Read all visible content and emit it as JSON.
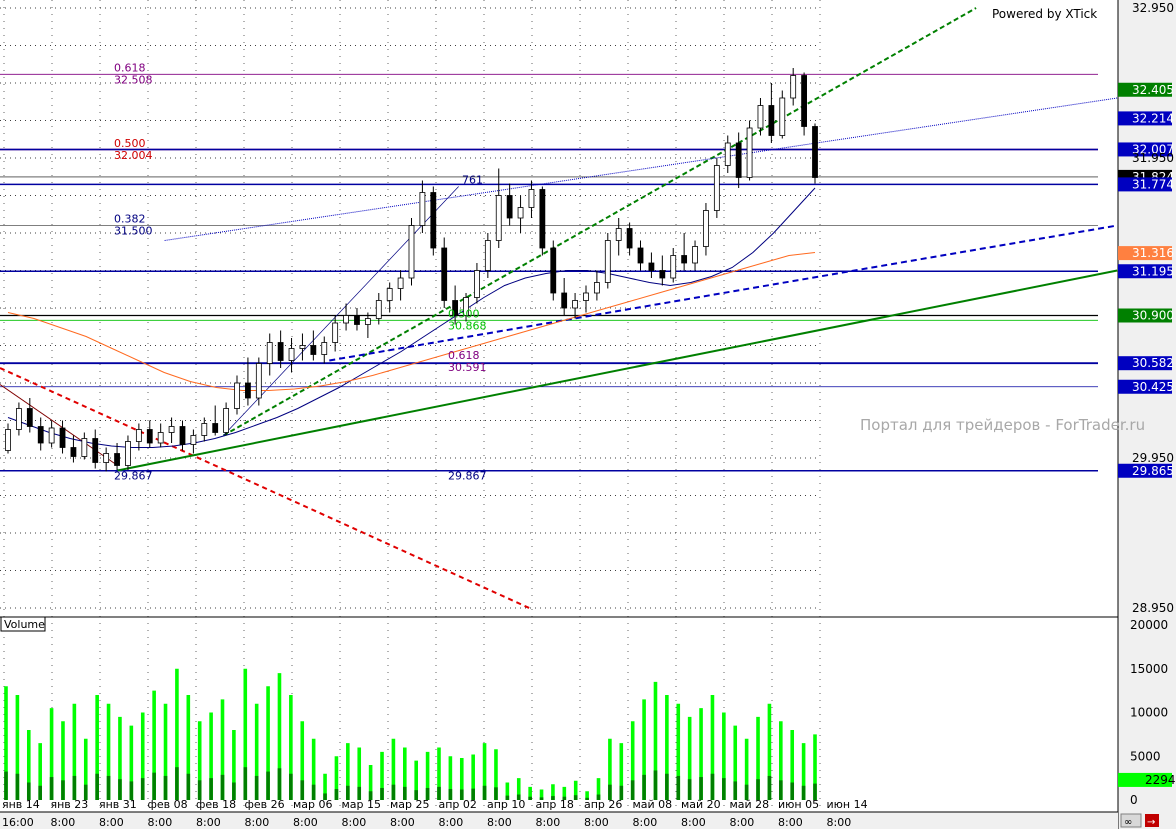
{
  "watermark": "Powered by XTick",
  "portal": "Портал для трейдеров - ForTrader.ru",
  "volume_label": "Volume",
  "colors": {
    "up": "#000000",
    "grid": "#000000",
    "fib_purple": "#800080",
    "fib_red": "#d00000",
    "fib_blue": "#000080",
    "fib_green": "#00c000",
    "hline_blue": "#0000a0",
    "trend_green": "#008000",
    "trend_red": "#e00000",
    "ma_orange": "#ff6a20",
    "ma_blue": "#000080",
    "volume": "#00ff00",
    "volume_dark": "#008000"
  },
  "chart_data": [
    {
      "type": "candlestick",
      "title": "",
      "ylim": [
        28.95,
        32.95
      ],
      "y_ticks": [
        "32.950",
        "31.950",
        "29.950",
        "28.950"
      ],
      "price_labels": [
        {
          "value": "32.405",
          "y": 32.405,
          "bg": "#008000",
          "fg": "#ffffff"
        },
        {
          "value": "32.214",
          "y": 32.214,
          "bg": "#0000c0",
          "fg": "#ffffff"
        },
        {
          "value": "32.007",
          "y": 32.007,
          "bg": "#0000c0",
          "fg": "#ffffff"
        },
        {
          "value": "31.824",
          "y": 31.824,
          "bg": "#000000",
          "fg": "#ffffff"
        },
        {
          "value": "31.774",
          "y": 31.774,
          "bg": "#0000c0",
          "fg": "#ffffff"
        },
        {
          "value": "31.316",
          "y": 31.316,
          "bg": "#ff8040",
          "fg": "#ffffff"
        },
        {
          "value": "31.195",
          "y": 31.195,
          "bg": "#0000c0",
          "fg": "#ffffff"
        },
        {
          "value": "30.900",
          "y": 30.9,
          "bg": "#008000",
          "fg": "#ffffff"
        },
        {
          "value": "30.582",
          "y": 30.582,
          "bg": "#0000c0",
          "fg": "#ffffff"
        },
        {
          "value": "30.425",
          "y": 30.425,
          "bg": "#0000c0",
          "fg": "#ffffff"
        },
        {
          "value": "29.865",
          "y": 29.865,
          "bg": "#0000c0",
          "fg": "#ffffff"
        }
      ],
      "fib_labels": [
        {
          "text": "0.618",
          "y": 32.508,
          "row": 0,
          "color": "#800080",
          "set": "a"
        },
        {
          "text": "32.508",
          "y": 32.508,
          "row": 1,
          "color": "#800080",
          "set": "a"
        },
        {
          "text": "0.500",
          "y": 32.004,
          "row": 0,
          "color": "#d00000",
          "set": "a"
        },
        {
          "text": "32.004",
          "y": 32.004,
          "row": 1,
          "color": "#d00000",
          "set": "a"
        },
        {
          "text": "0.382",
          "y": 31.5,
          "row": 0,
          "color": "#000080",
          "set": "a"
        },
        {
          "text": "31.500",
          "y": 31.5,
          "row": 1,
          "color": "#000080",
          "set": "a"
        },
        {
          "text": "29.867",
          "y": 29.867,
          "row": 1,
          "color": "#000080",
          "set": "a"
        },
        {
          "text": "0.500",
          "y": 30.868,
          "row": 0,
          "color": "#00c000",
          "set": "b"
        },
        {
          "text": "30.868",
          "y": 30.868,
          "row": 1,
          "color": "#00c000",
          "set": "b"
        },
        {
          "text": "0.618",
          "y": 30.591,
          "row": 0,
          "color": "#800080",
          "set": "b"
        },
        {
          "text": "30.591",
          "y": 30.591,
          "row": 1,
          "color": "#800080",
          "set": "b"
        },
        {
          "text": "29.867",
          "y": 29.867,
          "row": 1,
          "color": "#000080",
          "set": "b"
        },
        {
          "text": "761",
          "y": 31.76,
          "row": 0,
          "color": "#000080",
          "set": "c"
        }
      ],
      "hlines": [
        {
          "y": 32.007,
          "color": "#800080",
          "width": 1.5
        },
        {
          "y": 32.007,
          "color": "#0000a0",
          "width": 1.5
        },
        {
          "y": 31.774,
          "color": "#0000a0",
          "width": 1.5
        },
        {
          "y": 31.824,
          "color": "#000000",
          "width": 0.6
        },
        {
          "y": 31.195,
          "color": "#0000a0",
          "width": 1.5
        },
        {
          "y": 30.9,
          "color": "#000000",
          "width": 1.2
        },
        {
          "y": 30.582,
          "color": "#0000a0",
          "width": 1.8
        },
        {
          "y": 30.425,
          "color": "#0000a0",
          "width": 0.8
        },
        {
          "y": 29.865,
          "color": "#0000a0",
          "width": 1.5
        },
        {
          "y": 32.508,
          "color": "#800080",
          "width": 0.8
        },
        {
          "y": 31.5,
          "color": "#000000",
          "width": 0.6
        },
        {
          "y": 30.868,
          "color": "#00c000",
          "width": 0.8
        }
      ],
      "candles": [
        [
          30.0,
          30.18,
          29.98,
          30.14
        ],
        [
          30.14,
          30.32,
          30.1,
          30.28
        ],
        [
          30.28,
          30.35,
          30.12,
          30.16
        ],
        [
          30.16,
          30.22,
          30.0,
          30.05
        ],
        [
          30.05,
          30.2,
          30.02,
          30.15
        ],
        [
          30.15,
          30.2,
          29.98,
          30.02
        ],
        [
          30.02,
          30.1,
          29.92,
          29.96
        ],
        [
          29.96,
          30.12,
          29.94,
          30.08
        ],
        [
          30.08,
          30.14,
          29.88,
          29.92
        ],
        [
          29.92,
          30.02,
          29.86,
          29.98
        ],
        [
          29.98,
          30.05,
          29.87,
          29.9
        ],
        [
          29.9,
          30.1,
          29.87,
          30.06
        ],
        [
          30.06,
          30.18,
          30.0,
          30.14
        ],
        [
          30.14,
          30.2,
          30.02,
          30.05
        ],
        [
          30.05,
          30.18,
          30.02,
          30.12
        ],
        [
          30.12,
          30.22,
          30.05,
          30.16
        ],
        [
          30.16,
          30.2,
          30.0,
          30.04
        ],
        [
          30.04,
          30.14,
          29.98,
          30.1
        ],
        [
          30.1,
          30.22,
          30.06,
          30.18
        ],
        [
          30.18,
          30.3,
          30.1,
          30.12
        ],
        [
          30.12,
          30.32,
          30.1,
          30.28
        ],
        [
          30.28,
          30.5,
          30.24,
          30.45
        ],
        [
          30.45,
          30.62,
          30.3,
          30.35
        ],
        [
          30.35,
          30.62,
          30.3,
          30.58
        ],
        [
          30.58,
          30.78,
          30.5,
          30.72
        ],
        [
          30.72,
          30.8,
          30.55,
          30.6
        ],
        [
          30.6,
          30.75,
          30.52,
          30.68
        ],
        [
          30.68,
          30.78,
          30.6,
          30.7
        ],
        [
          30.7,
          30.8,
          30.6,
          30.64
        ],
        [
          30.64,
          30.76,
          30.58,
          30.72
        ],
        [
          30.72,
          30.9,
          30.66,
          30.85
        ],
        [
          30.85,
          30.98,
          30.8,
          30.9
        ],
        [
          30.9,
          30.95,
          30.8,
          30.84
        ],
        [
          30.84,
          30.92,
          30.75,
          30.88
        ],
        [
          30.88,
          31.05,
          30.84,
          31.0
        ],
        [
          31.0,
          31.12,
          30.92,
          31.08
        ],
        [
          31.08,
          31.2,
          31.0,
          31.15
        ],
        [
          31.15,
          31.55,
          31.1,
          31.5
        ],
        [
          31.5,
          31.8,
          31.45,
          31.72
        ],
        [
          31.72,
          31.76,
          31.3,
          31.35
        ],
        [
          31.35,
          31.42,
          30.95,
          31.0
        ],
        [
          31.0,
          31.1,
          30.84,
          30.9
        ],
        [
          30.9,
          31.05,
          30.86,
          31.02
        ],
        [
          31.02,
          31.25,
          30.98,
          31.2
        ],
        [
          31.2,
          31.45,
          31.15,
          31.4
        ],
        [
          31.4,
          31.88,
          31.35,
          31.7
        ],
        [
          31.7,
          31.78,
          31.5,
          31.55
        ],
        [
          31.55,
          31.7,
          31.45,
          31.62
        ],
        [
          31.62,
          31.8,
          31.55,
          31.74
        ],
        [
          31.74,
          31.76,
          31.3,
          31.35
        ],
        [
          31.35,
          31.4,
          31.0,
          31.05
        ],
        [
          31.05,
          31.15,
          30.9,
          30.95
        ],
        [
          30.95,
          31.05,
          30.88,
          31.0
        ],
        [
          31.0,
          31.1,
          30.92,
          31.05
        ],
        [
          31.05,
          31.2,
          31.0,
          31.12
        ],
        [
          31.12,
          31.45,
          31.08,
          31.4
        ],
        [
          31.4,
          31.55,
          31.3,
          31.48
        ],
        [
          31.48,
          31.52,
          31.3,
          31.35
        ],
        [
          31.35,
          31.4,
          31.2,
          31.25
        ],
        [
          31.25,
          31.32,
          31.15,
          31.2
        ],
        [
          31.2,
          31.3,
          31.1,
          31.15
        ],
        [
          31.15,
          31.35,
          31.12,
          31.3
        ],
        [
          31.3,
          31.45,
          31.2,
          31.25
        ],
        [
          31.25,
          31.4,
          31.2,
          31.36
        ],
        [
          31.36,
          31.65,
          31.3,
          31.6
        ],
        [
          31.6,
          31.95,
          31.55,
          31.9
        ],
        [
          31.9,
          32.1,
          31.85,
          32.05
        ],
        [
          32.05,
          32.12,
          31.75,
          31.82
        ],
        [
          31.82,
          32.2,
          31.8,
          32.15
        ],
        [
          32.15,
          32.35,
          32.1,
          32.3
        ],
        [
          32.3,
          32.45,
          32.05,
          32.1
        ],
        [
          32.1,
          32.4,
          32.08,
          32.35
        ],
        [
          32.35,
          32.55,
          32.3,
          32.5
        ],
        [
          32.5,
          32.52,
          32.1,
          32.16
        ],
        [
          32.16,
          32.18,
          31.78,
          31.82
        ]
      ],
      "mas": [
        {
          "name": "",
          "color": "#000080",
          "values": [
            30.22,
            30.17,
            30.12,
            30.08,
            30.05,
            30.03,
            30.02,
            30.02,
            30.03,
            30.05,
            30.08,
            30.12,
            30.17,
            30.22,
            30.28,
            30.35,
            30.42,
            30.5,
            30.58,
            30.66,
            30.75,
            30.84,
            30.93,
            31.02,
            31.1,
            31.15,
            31.18,
            31.2,
            31.2,
            31.18,
            31.15,
            31.12,
            31.1,
            31.12,
            31.16,
            31.22,
            31.32,
            31.45,
            31.6,
            31.75
          ]
        },
        {
          "name": "",
          "color": "#ff6a20",
          "values": [
            30.92,
            30.88,
            30.82,
            30.76,
            30.68,
            30.6,
            30.52,
            30.46,
            30.42,
            30.4,
            30.4,
            30.41,
            30.43,
            30.46,
            30.5,
            30.55,
            30.6,
            30.65,
            30.7,
            30.75,
            30.8,
            30.85,
            30.9,
            30.95,
            31.0,
            31.05,
            31.1,
            31.15,
            31.2,
            31.25,
            31.3,
            31.32
          ]
        }
      ],
      "trendlines": [
        {
          "x0": 0.0,
          "y0": 30.55,
          "x1": 0.45,
          "y1": 28.95,
          "color": "#e00000",
          "dash": "5,4",
          "width": 2
        },
        {
          "x0": 0.0,
          "y0": 30.44,
          "x1": 0.1,
          "y1": 29.9,
          "color": "#800000",
          "dash": "",
          "width": 1
        },
        {
          "x0": 0.1,
          "y0": 29.867,
          "x1": 0.95,
          "y1": 31.2,
          "color": "#008000",
          "dash": "",
          "width": 2
        },
        {
          "x0": 0.19,
          "y0": 30.1,
          "x1": 0.83,
          "y1": 32.95,
          "color": "#008000",
          "dash": "5,3",
          "width": 2
        },
        {
          "x0": 0.28,
          "y0": 30.6,
          "x1": 0.95,
          "y1": 31.5,
          "color": "#0000c0",
          "dash": "6,4",
          "width": 2
        },
        {
          "x0": 0.14,
          "y0": 31.4,
          "x1": 0.95,
          "y1": 32.35,
          "color": "#0000c0",
          "dash": "1,1",
          "width": 1
        },
        {
          "x0": 0.19,
          "y0": 30.1,
          "x1": 0.39,
          "y1": 31.76,
          "color": "#000080",
          "dash": "",
          "width": 0.7
        }
      ],
      "x_ticks_top": [
        "янв 14",
        "янв 23",
        "янв 31",
        "фев 08",
        "фев 18",
        "фев 26",
        "мар 06",
        "мар 15",
        "мар 25",
        "апр 02",
        "апр 10",
        "апр 18",
        "апр 26",
        "май 08",
        "май 20",
        "май 28",
        "июн 05",
        "июн 14"
      ],
      "x_ticks_bottom": [
        "16:00",
        "8:00",
        "8:00",
        "8:00",
        "8:00",
        "8:00",
        "8:00",
        "8:00",
        "8:00",
        "8:00",
        "8:00",
        "8:00",
        "8:00",
        "8:00",
        "8:00",
        "8:00",
        "8:00",
        "8:00"
      ]
    },
    {
      "type": "bar",
      "title": "Volume",
      "ylim": [
        0,
        20000
      ],
      "y_ticks": [
        "20000",
        "15000",
        "10000",
        "5000",
        "0"
      ],
      "last_value": "2294",
      "values": [
        13000,
        12000,
        8000,
        6500,
        10500,
        9000,
        11000,
        7000,
        12000,
        11000,
        9500,
        8500,
        10000,
        12500,
        11000,
        15000,
        12000,
        9000,
        10000,
        11500,
        8000,
        15000,
        11000,
        13000,
        14500,
        12000,
        9000,
        7000,
        3000,
        5000,
        6500,
        6000,
        4000,
        5500,
        7000,
        6000,
        4500,
        5500,
        6000,
        5000,
        4800,
        5200,
        6500,
        5800,
        2000,
        2500,
        1500,
        1200,
        1800,
        1500,
        2200,
        1000,
        2500,
        7000,
        6500,
        9000,
        11500,
        13500,
        12000,
        11000,
        9500,
        10500,
        12000,
        10000,
        8500,
        7000,
        9500,
        11000,
        9000,
        8000,
        6500,
        7500
      ]
    }
  ]
}
